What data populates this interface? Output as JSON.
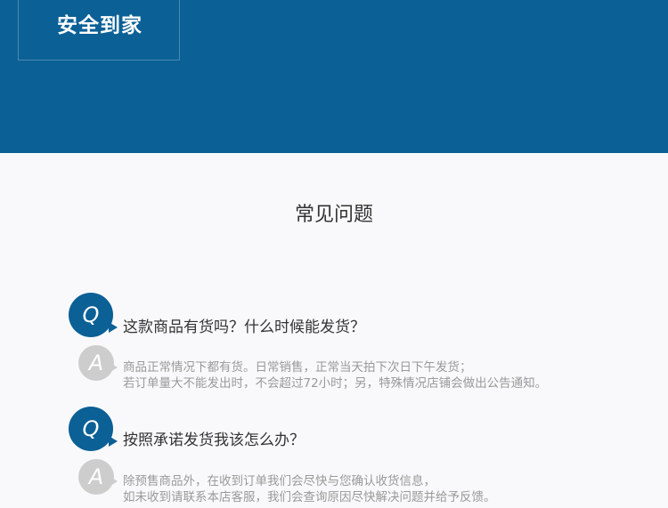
{
  "banner": {
    "title": "安全到家"
  },
  "faq": {
    "title": "常见问题",
    "q_letter": "Q",
    "a_letter": "A",
    "items": [
      {
        "question": "这款商品有货吗？什么时候能发货？",
        "answer_lines": [
          "商品正常情况下都有货。日常销售，正常当天拍下次日下午发货；",
          "若订单量大不能发出时，不会超过72小时；另，特殊情况店铺会做出公告通知。"
        ]
      },
      {
        "question": "按照承诺发货我该怎么办？",
        "answer_lines": [
          "除预售商品外，在收到订单我们会尽快与您确认收货信息，",
          "如未收到请联系本店客服，我们会查询原因尽快解决问题并给予反馈。"
        ]
      }
    ]
  },
  "colors": {
    "primary": "#0b6096",
    "answer_badge": "#cdcdcd",
    "question_text": "#333333",
    "answer_text": "#999999"
  }
}
